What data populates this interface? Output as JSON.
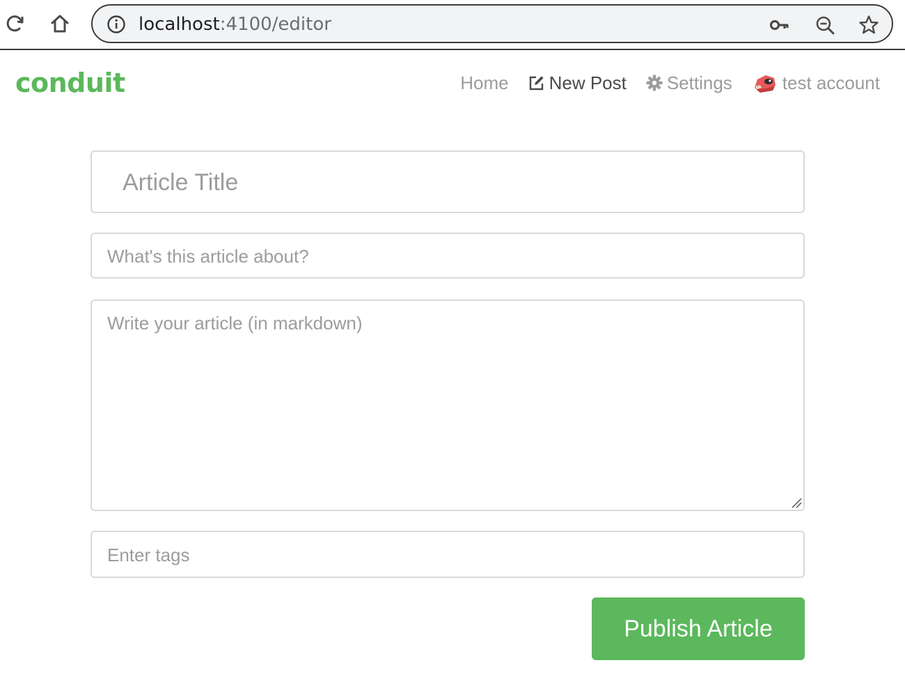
{
  "browser": {
    "url_host": "localhost",
    "url_path": ":4100/editor",
    "icons": [
      "reload-icon",
      "home-icon",
      "info-icon",
      "key-icon",
      "zoom-out-icon",
      "star-icon"
    ]
  },
  "navbar": {
    "brand": "conduit",
    "links": {
      "home": "Home",
      "new_post": "New Post",
      "settings": "Settings",
      "profile": "test account"
    },
    "active": "new_post"
  },
  "editor": {
    "title_placeholder": "Article Title",
    "description_placeholder": "What's this article about?",
    "body_placeholder": "Write your article (in markdown)",
    "tags_placeholder": "Enter tags",
    "publish_label": "Publish Article"
  },
  "colors": {
    "brand": "#5cb85c",
    "button": "#5cb85c",
    "placeholder": "#9c9c9c",
    "nav_inactive": "#9b9b9b",
    "nav_active": "#4a4a4a"
  }
}
